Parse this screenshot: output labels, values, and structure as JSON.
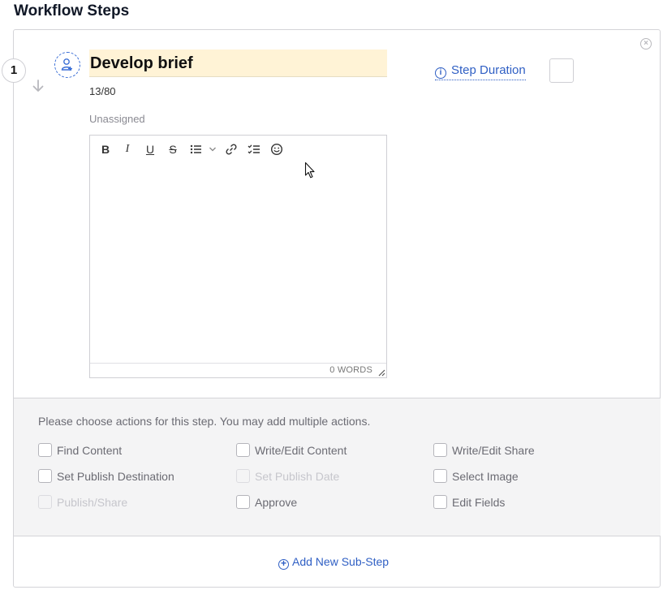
{
  "page": {
    "title": "Workflow Steps"
  },
  "step": {
    "number": "1",
    "name": "Develop brief",
    "char_count": "13/80",
    "assignee": "Unassigned",
    "duration_label": "Step Duration",
    "duration_value": "",
    "description": "",
    "word_count": "0 WORDS"
  },
  "toolbar": {
    "bold": "B",
    "italic": "I",
    "underline": "U",
    "strike": "S"
  },
  "actions": {
    "prompt": "Please choose actions for this step. You may add multiple actions.",
    "items": [
      {
        "label": "Find Content",
        "checked": false,
        "disabled": false
      },
      {
        "label": "Write/Edit Content",
        "checked": false,
        "disabled": false
      },
      {
        "label": "Write/Edit Share",
        "checked": false,
        "disabled": false
      },
      {
        "label": "Set Publish Destination",
        "checked": false,
        "disabled": false
      },
      {
        "label": "Set Publish Date",
        "checked": false,
        "disabled": true
      },
      {
        "label": "Select Image",
        "checked": false,
        "disabled": false
      },
      {
        "label": "Publish/Share",
        "checked": false,
        "disabled": true
      },
      {
        "label": "Approve",
        "checked": false,
        "disabled": false
      },
      {
        "label": "Edit Fields",
        "checked": false,
        "disabled": false
      }
    ]
  },
  "footer": {
    "add_substep_label": "Add New Sub-Step"
  },
  "colors": {
    "accent": "#2f5fc4",
    "title_highlight": "#fff3d6",
    "actions_bg": "#f4f4f5"
  }
}
